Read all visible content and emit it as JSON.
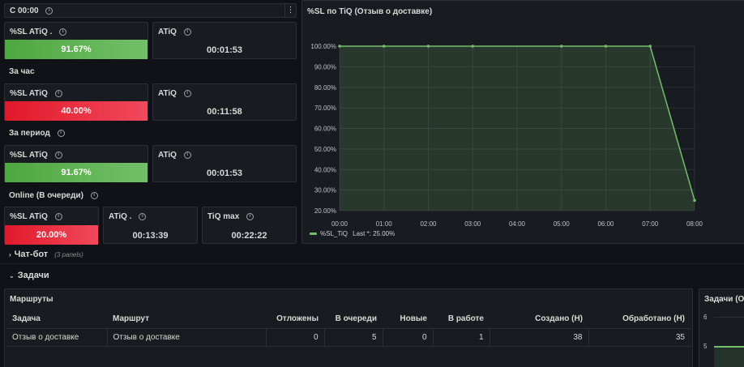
{
  "top_row": {
    "title": "С 00:00",
    "menu_icon": "kebab-menu-icon"
  },
  "current": {
    "sl": {
      "title": "%SL ATiQ .",
      "value": "91.67%",
      "fill": 0.9167,
      "color": "#73bf69"
    },
    "atiq": {
      "title": "ATiQ",
      "value": "00:01:53"
    }
  },
  "hour": {
    "label": "За час",
    "sl": {
      "title": "%SL ATiQ",
      "value": "40.00%",
      "fill": 0.4,
      "color": "#f2495c"
    },
    "atiq": {
      "title": "ATiQ",
      "value": "00:11:58"
    }
  },
  "period": {
    "label": "За период",
    "sl": {
      "title": "%SL ATiQ",
      "value": "91.67%",
      "fill": 0.9167,
      "color": "#73bf69"
    },
    "atiq": {
      "title": "ATiQ",
      "value": "00:01:53"
    }
  },
  "online": {
    "label": "Online (В очереди)",
    "sl": {
      "title": "%SL ATiQ",
      "value": "20.00%",
      "fill": 0.2,
      "color": "#f2495c"
    },
    "atiq": {
      "title": "ATiQ .",
      "value": "00:13:39"
    },
    "tiq": {
      "title": "TiQ max",
      "value": "00:22:22"
    }
  },
  "chart_panel": {
    "title": "%SL по TiQ (Отзыв о доставке)"
  },
  "chart_data": {
    "type": "area",
    "x": [
      "00:00",
      "01:00",
      "02:00",
      "03:00",
      "04:00",
      "05:00",
      "06:00",
      "07:00",
      "08:00"
    ],
    "y_ticks": [
      "100.00%",
      "90.00%",
      "80.00%",
      "70.00%",
      "60.00%",
      "50.00%",
      "40.00%",
      "30.00%",
      "20.00%"
    ],
    "ylim": [
      20,
      100
    ],
    "series": [
      {
        "name": "%SL_TiQ",
        "color": "#73bf69",
        "points": [
          {
            "x": 0,
            "y": 100
          },
          {
            "x": 1,
            "y": 100
          },
          {
            "x": 2,
            "y": 100
          },
          {
            "x": 3,
            "y": 100
          },
          {
            "x": 5,
            "y": 100
          },
          {
            "x": 6,
            "y": 100
          },
          {
            "x": 7,
            "y": 100
          },
          {
            "x": 8,
            "y": 25
          }
        ]
      }
    ],
    "legend": {
      "name": "%SL_TiQ",
      "last": "Last *: 25.00%"
    },
    "grid": true
  },
  "rows": {
    "chatbot": {
      "label": "Чат-бот",
      "count": "(3 panels)"
    },
    "tasks": {
      "label": "Задачи"
    }
  },
  "routes": {
    "title": "Маршруты",
    "columns": [
      "Задача",
      "Маршрут",
      "Отложены",
      "В очереди",
      "Новые",
      "В работе",
      "Создано (Н)",
      "Обработано (Н)"
    ],
    "rows": [
      [
        "Отзыв о доставке",
        "Отзыв о доставке",
        "0",
        "5",
        "0",
        "1",
        "38",
        "35"
      ]
    ]
  },
  "tasks_chart": {
    "title": "Задачи (От",
    "y_top": "6",
    "y_mid": "5"
  }
}
